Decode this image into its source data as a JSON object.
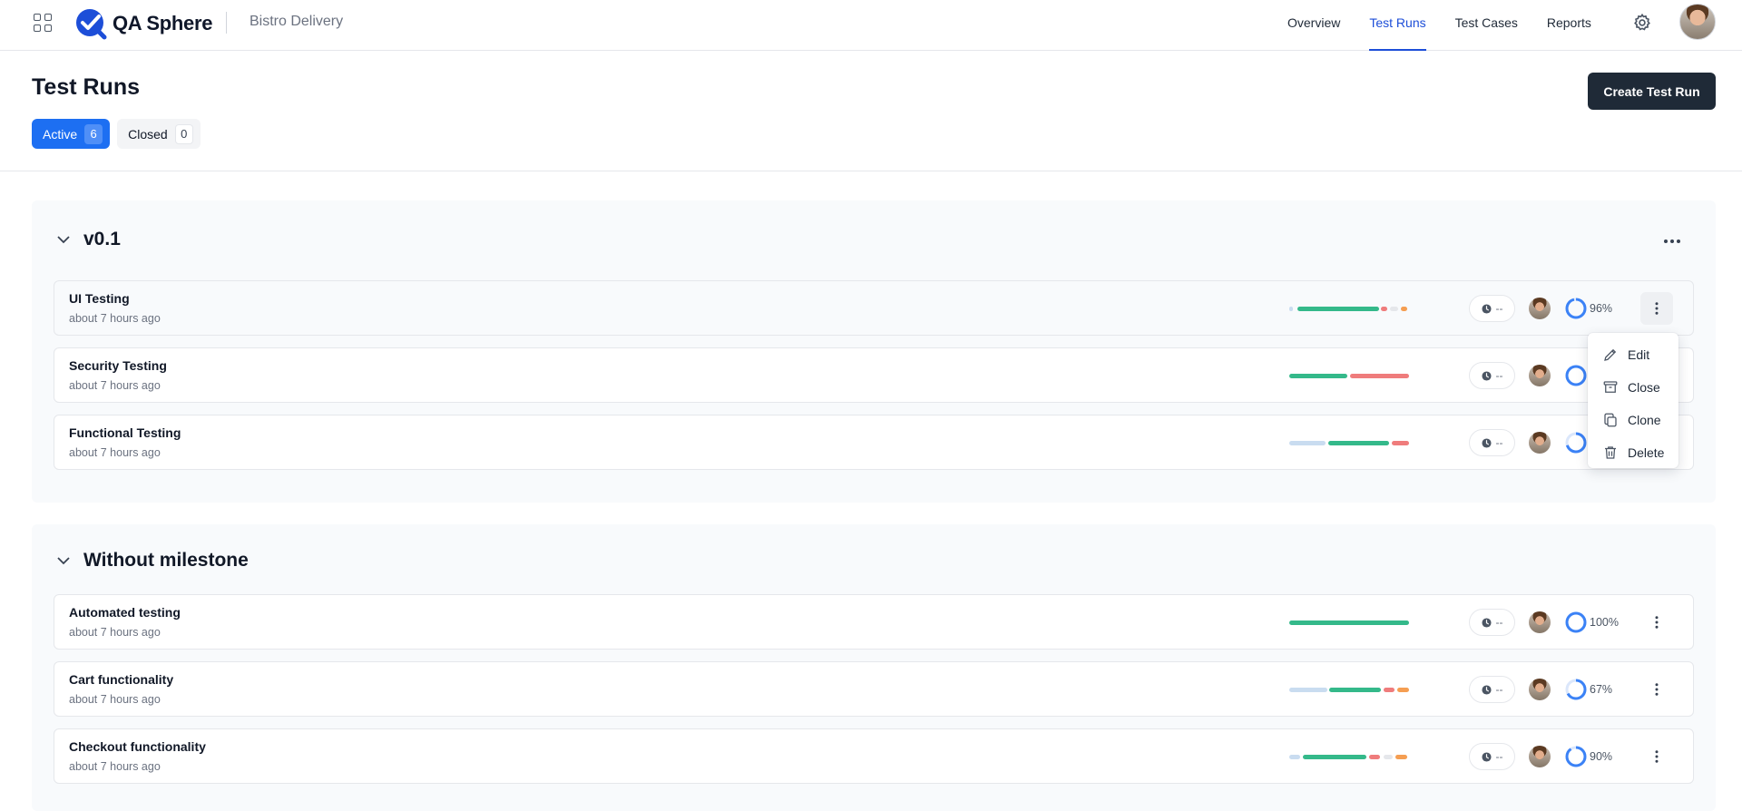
{
  "app": {
    "name": "QA Sphere",
    "project": "Bistro Delivery"
  },
  "nav": {
    "overview": "Overview",
    "test_runs": "Test Runs",
    "test_cases": "Test Cases",
    "reports": "Reports"
  },
  "page": {
    "title": "Test Runs",
    "create_button": "Create Test Run"
  },
  "tabs": {
    "active": {
      "label": "Active",
      "count": "6"
    },
    "closed": {
      "label": "Closed",
      "count": "0"
    }
  },
  "groups": [
    {
      "title": "v0.1",
      "runs": [
        {
          "name": "UI Testing",
          "time": "about 7 hours ago",
          "duration": "--",
          "progress": "96%",
          "progress_value": 0.96
        },
        {
          "name": "Security Testing",
          "time": "about 7 hours ago",
          "duration": "--",
          "progress": "",
          "progress_value": 1.0
        },
        {
          "name": "Functional Testing",
          "time": "about 7 hours ago",
          "duration": "--",
          "progress": "",
          "progress_value": 0.7
        }
      ]
    },
    {
      "title": "Without milestone",
      "runs": [
        {
          "name": "Automated testing",
          "time": "about 7 hours ago",
          "duration": "--",
          "progress": "100%",
          "progress_value": 1.0
        },
        {
          "name": "Cart functionality",
          "time": "about 7 hours ago",
          "duration": "--",
          "progress": "67%",
          "progress_value": 0.67
        },
        {
          "name": "Checkout functionality",
          "time": "about 7 hours ago",
          "duration": "--",
          "progress": "90%",
          "progress_value": 0.9
        }
      ]
    }
  ],
  "menu": {
    "edit": "Edit",
    "close": "Close",
    "clone": "Clone",
    "delete": "Delete"
  },
  "colors": {
    "accent": "#1d6ff2",
    "passed": "#34b98a",
    "failed": "#ef7c7c",
    "blocked": "#f59e52",
    "untested": "#c9dcf0",
    "skipped": "#e5e7eb",
    "ring": "#3b82f6"
  }
}
